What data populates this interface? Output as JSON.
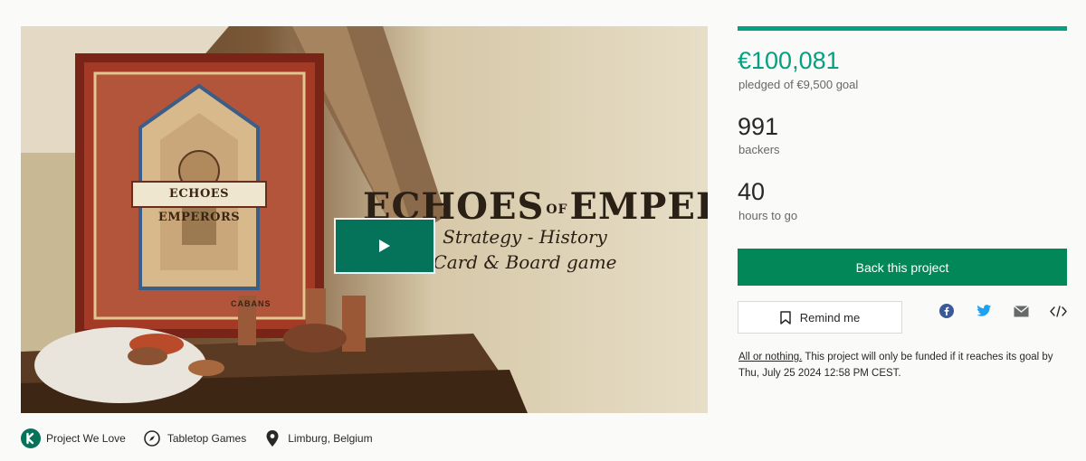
{
  "hero": {
    "title_a": "ECHOES",
    "title_of": "OF",
    "title_b": "EMPERORS",
    "subtitle_1": "Strategy - History",
    "subtitle_2": "Card & Board game",
    "box_label": "ECHOES EMPERORS",
    "box_publisher": "CABANS"
  },
  "tags": [
    {
      "label": "Project We Love",
      "icon": "kickstarter-badge-icon"
    },
    {
      "label": "Tabletop Games",
      "icon": "compass-icon"
    },
    {
      "label": "Limburg, Belgium",
      "icon": "location-pin-icon"
    }
  ],
  "stats": {
    "progress_fraction": 1.0,
    "pledged": "€100,081",
    "pledged_sub": "pledged of €9,500 goal",
    "backers": "991",
    "backers_sub": "backers",
    "hours": "40",
    "hours_sub": "hours to go"
  },
  "actions": {
    "back_label": "Back this project",
    "remind_label": "Remind me",
    "share_icons": [
      "facebook-icon",
      "twitter-icon",
      "email-icon",
      "embed-icon"
    ]
  },
  "fine_print": {
    "link": "All or nothing.",
    "text": " This project will only be funded if it reaches its goal by Thu, July 25 2024 12:58 PM CEST."
  },
  "colors": {
    "accent_green": "#05a081",
    "button_green": "#028858",
    "play_green": "#05735a"
  }
}
